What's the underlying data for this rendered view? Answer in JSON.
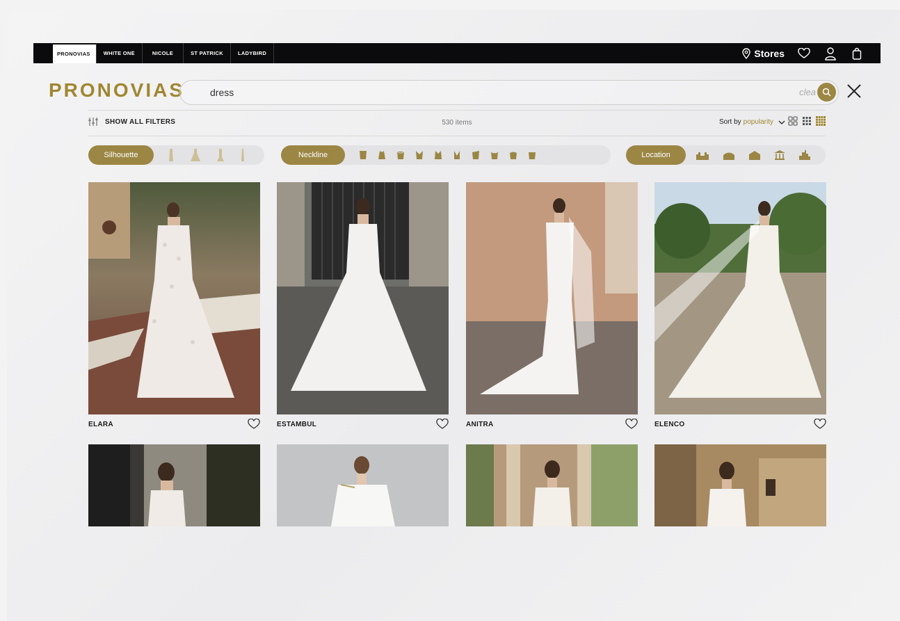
{
  "brand_tabs": [
    "PRONOVIAS",
    "WHITE ONE",
    "NICOLE",
    "ST PATRICK",
    "LADYBIRD"
  ],
  "stores_label": "Stores",
  "logo": "PRONOVIAS",
  "search": {
    "value": "dress",
    "clear_label": "clea"
  },
  "filters_label": "SHOW ALL FILTERS",
  "items_count": "530 items",
  "sort": {
    "prefix": "Sort by",
    "value": "popularity"
  },
  "chips": {
    "silhouette": "Silhouette",
    "neckline": "Neckline",
    "location": "Location"
  },
  "products": [
    {
      "name": "ELARA"
    },
    {
      "name": "ESTAMBUL"
    },
    {
      "name": "ANITRA"
    },
    {
      "name": "ELENCO"
    }
  ],
  "colors": {
    "gold": "#a08732",
    "chip": "#9b8644",
    "topbar": "#0b0b0d"
  }
}
